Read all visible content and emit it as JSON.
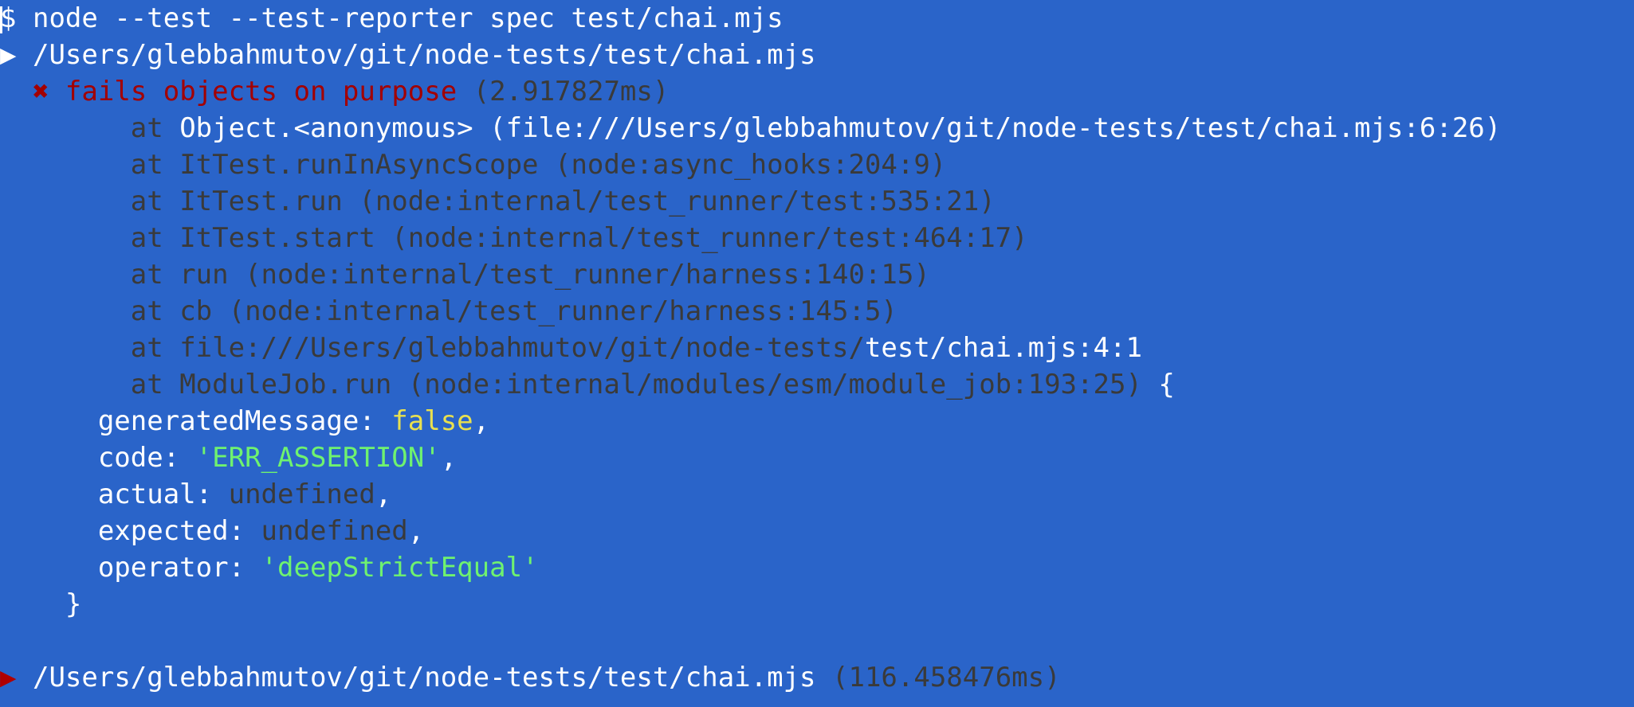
{
  "terminal": {
    "prompt": "$",
    "command": "node --test --test-reporter spec test/chai.mjs",
    "suite_marker": "▶",
    "suite_path": "/Users/glebbahmutov/git/node-tests/test/chai.mjs",
    "fail_marker": "✖",
    "test_name": "fails objects on purpose",
    "test_duration": "(2.917827ms)",
    "stack": [
      {
        "prefix": "at ",
        "dim": "",
        "bright": "Object.<anonymous> (file:///Users/glebbahmutov/git/node-tests/test/chai.mjs:6:26)"
      },
      {
        "prefix": "at ",
        "dim": "ItTest.runInAsyncScope (node:async_hooks:204:9)",
        "bright": ""
      },
      {
        "prefix": "at ",
        "dim": "ItTest.run (node:internal/test_runner/test:535:21)",
        "bright": ""
      },
      {
        "prefix": "at ",
        "dim": "ItTest.start (node:internal/test_runner/test:464:17)",
        "bright": ""
      },
      {
        "prefix": "at ",
        "dim": "run (node:internal/test_runner/harness:140:15)",
        "bright": ""
      },
      {
        "prefix": "at ",
        "dim": "cb (node:internal/test_runner/harness:145:5)",
        "bright": ""
      },
      {
        "prefix": "at ",
        "dim": "file:///Users/glebbahmutov/git/node-tests/",
        "bright": "test/chai.mjs:4:1"
      },
      {
        "prefix": "at ",
        "dim": "ModuleJob.run (node:internal/modules/esm/module_job:193:25)",
        "bright": " {"
      }
    ],
    "props": {
      "generatedMessage_key": "generatedMessage: ",
      "generatedMessage_value": "false",
      "code_key": "code: ",
      "code_value": "'ERR_ASSERTION'",
      "actual_key": "actual: ",
      "actual_value": "undefined",
      "expected_key": "expected: ",
      "expected_value": "undefined",
      "operator_key": "operator: ",
      "operator_value": "'deepStrictEqual'",
      "comma": ",",
      "close_brace": "}"
    },
    "summary_marker": "▶",
    "summary_path": "/Users/glebbahmutov/git/node-tests/test/chai.mjs",
    "summary_duration": "(116.458476ms)"
  }
}
